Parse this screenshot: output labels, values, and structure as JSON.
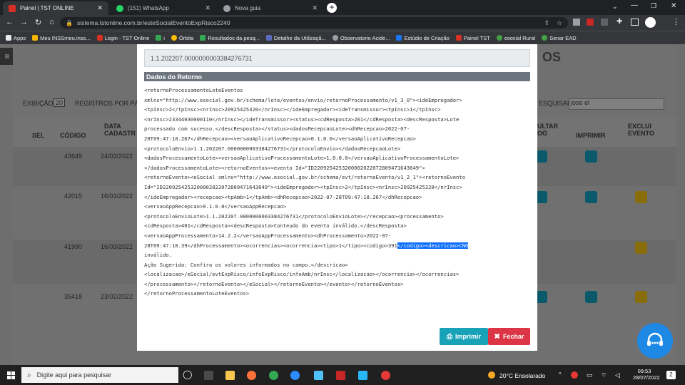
{
  "browser": {
    "tabs": [
      {
        "title": "Painel | TST ONLINE",
        "active": true
      },
      {
        "title": "(151) WhatsApp",
        "active": false
      },
      {
        "title": "Nova guia",
        "active": false
      }
    ],
    "url": "sistema.tstonline.com.br/esteSocialEventoExpRisco2240",
    "bookmarks": [
      "Apps",
      "Meu INSSmeu.inss...",
      "Login - TST Online",
      "i",
      "Órbita",
      "Resultados da pesq...",
      "Detalhe da Utilizaçã...",
      "Observatorio Acide...",
      "Estúdio de Criação",
      "Painel TST",
      "esocial Rural",
      "Senar EAD"
    ]
  },
  "background_page": {
    "title_fragment": "OS",
    "show_label": "EXIBIÇÃO",
    "page_size": "20",
    "records_label": "REGISTROS POR PÁ",
    "search_label": "ESQUISAR:",
    "search_value": "jose el",
    "columns": [
      "SEL",
      "CÓDIGO",
      "DATA CADASTR",
      "ULTAR OG",
      "IMPRIMIR",
      "EXCLUI EVENTO"
    ],
    "rows": [
      {
        "code": "43649",
        "date": "24/03/2022"
      },
      {
        "code": "42015",
        "date": "16/03/2022"
      },
      {
        "code": "41990",
        "date": "16/03/2022"
      },
      {
        "code": "35418",
        "date": "23/02/2022"
      }
    ]
  },
  "modal": {
    "protocol": "1.1.202207.0000000003384276731",
    "section_title": "Dados do Retorno",
    "xml_lines": [
      "<retornoProcessamentoLoteEventos",
      "xmlns=\"http://www.esocial.gov.br/schema/lote/eventos/envio/retornoProcessamento/v1_3_0\"><ideEmpregador>",
      "<tpInsc>2</tpInsc><nrInsc>20925425320</nrInsc></ideEmpregador><ideTransmissor><tpInsc>1</tpInsc>",
      "<nrInsc>23344030000110</nrInsc></ideTransmissor><status><cdResposta>201</cdResposta><descResposta>Lote",
      "processado com sucesso.</descResposta></status><dadosRecepcaoLote><dhRecepcao>2022-07-",
      "28T09:47:18.267</dhRecepcao><versaoAplicativoRecepcao>0.1.0.0</versaoAplicativoRecepcao>",
      "<protocoloEnvio>1.1.202207.0000000003384276731</protocoloEnvio></dadosRecepcaoLote>",
      "<dadosProcessamentoLote><versaoAplicativoProcessamentoLote>1.0.0.0</versaoAplicativoProcessamentoLote>",
      "</dadosProcessamentoLote><retornoEventos><evento Id=\"ID2209254253200002022072809471643649\">",
      "<retornoEvento><eSocial xmlns=\"http://www.esocial.gov.br/schema/evt/retornoEvento/v1_2_1\"><retornoEvento",
      "Id=\"ID2209254253200002022072809471643649\"><ideEmpregador><tpInsc>2</tpInsc><nrInsc>20925425320</nrInsc>",
      "</ideEmpregador><recepcao><tpAmb>1</tpAmb><dhRecepcao>2022-07-28T09:47:18.267</dhRecepcao>",
      "<versaoAppRecepcao>0.1.0.0</versaoAppRecepcao>",
      "<protocoloEnvioLote>1.1.202207.0000000003384276731</protocoloEnvioLote></recepcao><processamento>",
      "<cdResposta>401</cdResposta><descResposta>Conteudo do evento inválido.</descResposta>",
      "<versaoAppProcessamento>14.2.2</versaoAppProcessamento><dhProcessamento>2022-07-",
      "28T09:47:18.39</dhProcessamento><ocorrencias><ocorrencia><tipo>1</tipo><codigo>391",
      "inválido.",
      "Ação Sugerida: Confira os valores informados no campo.</descricao>",
      "<localizacao>/eSocial/evtExpRisco/infoExpRisco/infoAmb/nrInsc</localizacao></ocorrencia></ocorrencias>",
      "</processamento></retornoEvento></eSocial></retornoEvento></evento></retornoEventos>",
      "</retornoProcessamentoLoteEventos>"
    ],
    "selected_text": "</codigo><descricao>CNO",
    "print_label": "Imprimir",
    "close_label": "Fechar"
  },
  "taskbar": {
    "search_placeholder": "Digite aqui para pesquisar",
    "weather": "20°C  Ensolarado",
    "time": "09:53",
    "date": "28/07/2022",
    "notifications": "2"
  },
  "colors": {
    "accent_teal": "#17a2b8",
    "danger": "#dc3545",
    "header_gray": "#6c757d",
    "help_blue": "#1e88e5"
  }
}
